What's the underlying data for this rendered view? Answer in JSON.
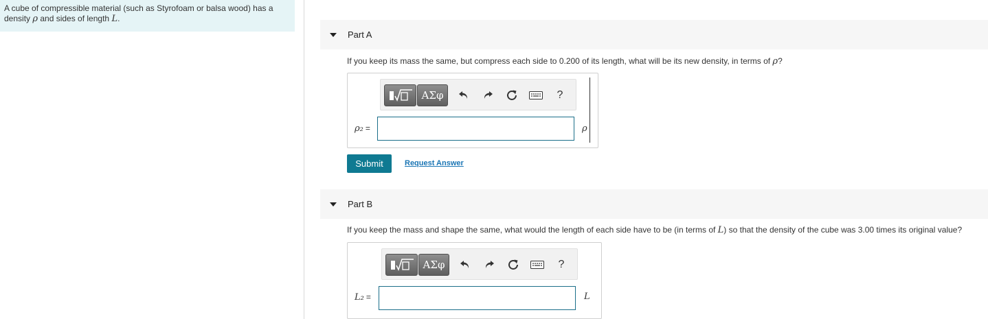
{
  "intro": {
    "text_before_rho": "A cube of compressible material (such as Styrofoam or balsa wood) has a density ",
    "rho_symbol": "ρ",
    "text_between": " and sides of length ",
    "L_symbol": "L",
    "text_end": "."
  },
  "toolbar": {
    "matrix_glyph": "▮√□",
    "greek_label": "ΑΣφ",
    "help_label": "?"
  },
  "part_a": {
    "title": "Part A",
    "question_before": "If you keep its mass the same, but compress each side to 0.200 of its length, what will be its new density, in terms of ",
    "question_symbol": "ρ",
    "question_after": "?",
    "var_label": "ρ₂",
    "equals": "=",
    "input_value": "",
    "unit": "ρ",
    "submit_label": "Submit",
    "request_label": "Request Answer"
  },
  "part_b": {
    "title": "Part B",
    "question_before": "If you keep the mass and shape the same, what would the length of each side have to be (in terms of ",
    "question_symbol": "L",
    "question_after": ") so that the density of the cube was 3.00 times its original value?",
    "var_label": "L₂",
    "equals": "=",
    "input_value": "",
    "unit": "L"
  },
  "icons": [
    "matrix-sqrt-icon",
    "greek-icon",
    "undo-icon",
    "redo-icon",
    "reset-icon",
    "keyboard-icon",
    "help-icon",
    "caret-down-icon"
  ]
}
